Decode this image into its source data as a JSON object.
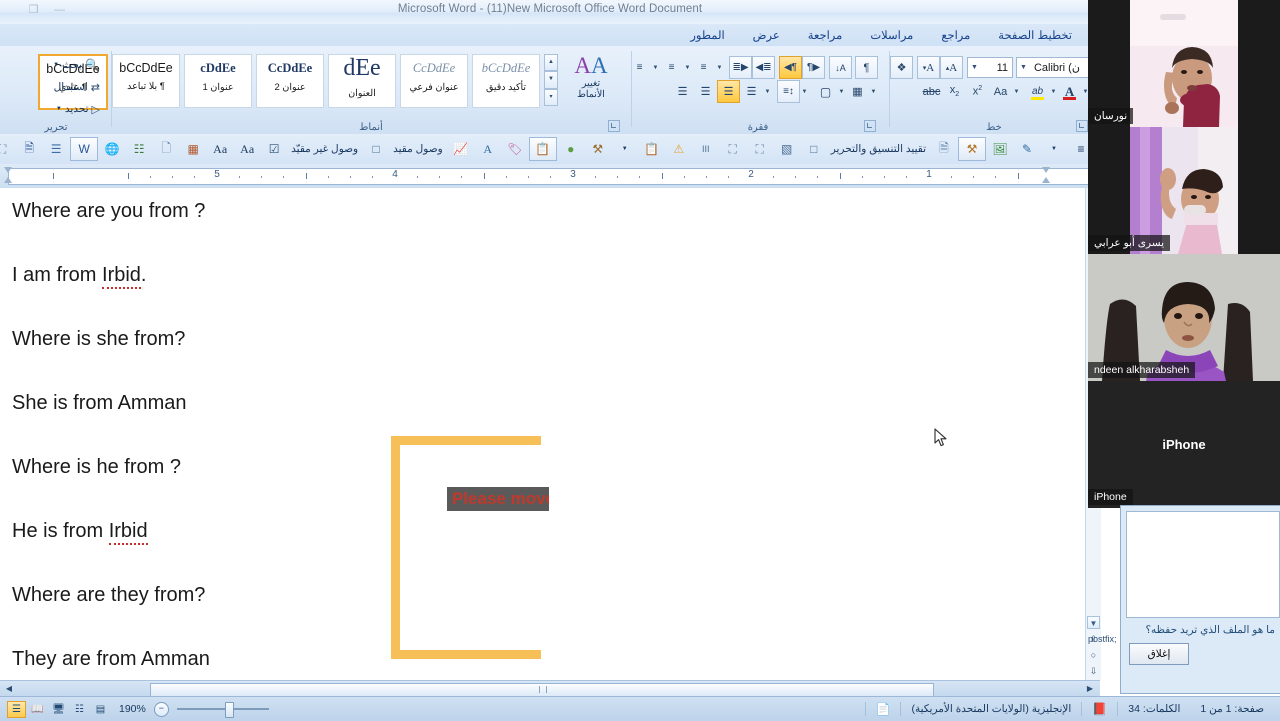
{
  "window": {
    "title": "Microsoft Word - (11)New Microsoft Office Word Document",
    "restore_icon": "restore-icon",
    "minimize_icon": "minimize-icon"
  },
  "ribbon": {
    "tabs": [
      {
        "label": "تخطيط الصفحة"
      },
      {
        "label": "مراجع"
      },
      {
        "label": "مراسلات"
      },
      {
        "label": "مراجعة"
      },
      {
        "label": "عرض"
      },
      {
        "label": "المطور"
      }
    ],
    "font_group": {
      "label": "خط",
      "font_name": "Calibri (ن",
      "font_size": "11",
      "grow_font": "A",
      "shrink_font": "A",
      "clear_formatting_icon": "clear-formatting-icon",
      "text_color": "A",
      "highlight": "ab",
      "change_case": "Aa",
      "superscript": "x²",
      "subscript": "x₂",
      "strikethrough": "abc",
      "text_color_hex": "#d81e1e",
      "highlight_color_hex": "#ffe800"
    },
    "paragraph_group": {
      "label": "فقرة",
      "show_marks": "¶",
      "sort": "A↓",
      "ltr_text": "¶",
      "rtl_text": "¶",
      "decrease_indent": "≡",
      "increase_indent": "≡",
      "multilevel_list": "≡",
      "numbered_list": "≡",
      "bulleted_list": "≡",
      "borders": "▦",
      "shading": "▤",
      "line_spacing": "↕",
      "align_left": "≡",
      "align_center": "≡",
      "align_right": "≡",
      "justify": "≡"
    },
    "styles_group": {
      "label": "أنماط",
      "change_styles_label_line1": "تغيير",
      "change_styles_label_line2": "الأنماط",
      "items": [
        {
          "preview": "bCcDdEe",
          "name": "تأكيد دقيق",
          "selected": false
        },
        {
          "preview": "CcDdEe",
          "name": "عنوان فرعي",
          "selected": false
        },
        {
          "preview": "dEe",
          "name": "العنوان",
          "selected": false
        },
        {
          "preview": "CcDdEe",
          "name": "عنوان 2",
          "selected": false
        },
        {
          "preview": "cDdEe",
          "name": "عنوان 1",
          "selected": false
        },
        {
          "preview": "bCcDdEe",
          "name": "¶ بلا تباعد",
          "selected": false
        },
        {
          "preview": "bCcDdEe",
          "name": "¶ عادي",
          "selected": true
        }
      ]
    },
    "editing_group": {
      "label": "تحرير",
      "find": "بحث",
      "replace": "استبدال",
      "select": "تحديد"
    }
  },
  "addin_toolbar": {
    "restrict_formatting_label": "تقييد التنسيق والتحرير",
    "restricted_access_label": "وصول مقيد",
    "unrestricted_access_label": "وصول غير مقيّد",
    "case_upper": "Aa",
    "case_lower": "Aa",
    "overflow_icon": "overflow-chevron-icon",
    "warning_icon": "warning-icon"
  },
  "ruler": {
    "numbers": [
      "5",
      "4",
      "3",
      "2",
      "1"
    ]
  },
  "document": {
    "lines": [
      {
        "text": "Where are you from ?",
        "misspelled": ""
      },
      {
        "text": "I am from ",
        "misspelled": "Irbid",
        "tail": "."
      },
      {
        "text": "Where is she from?",
        "misspelled": ""
      },
      {
        "text": "She is from Amman",
        "misspelled": ""
      },
      {
        "text": "Where is he from ?",
        "misspelled": ""
      },
      {
        "text": "He is from ",
        "misspelled": "Irbid",
        "tail": ""
      },
      {
        "text": "Where are they from?",
        "misspelled": ""
      },
      {
        "text": "They are from Amman",
        "misspelled": ""
      }
    ],
    "annotation": {
      "text": "Please move",
      "box_color": "#f7bf57",
      "text_color": "#c0392b",
      "text_background": "#5a5a5a"
    }
  },
  "video_panel": {
    "tiles": [
      {
        "name": "نورسان",
        "rtl": true,
        "kind": "camera",
        "center_label": ""
      },
      {
        "name": "يسرى أبو عرابي",
        "rtl": true,
        "kind": "camera",
        "center_label": ""
      },
      {
        "name": "ndeen alkharabsheh",
        "rtl": false,
        "kind": "camera",
        "center_label": ""
      },
      {
        "name": "iPhone",
        "rtl": false,
        "kind": "placeholder",
        "center_label": "iPhone"
      }
    ]
  },
  "save_dialog": {
    "message": "ما هو الملف الذي تريد حفظه؟",
    "close_button": "إغلاق"
  },
  "status_bar": {
    "page": "صفحة: 1 من 1",
    "words": "الكلمات: 34",
    "proofing_icon": "proofing-errors-icon",
    "language": "الإنجليزية (الولايات المتحدة الأمريكية)",
    "macro_icon": "macro-record-icon",
    "zoom_level": "190%",
    "zoom_out": "−",
    "views": [
      {
        "icon": "print-layout-icon",
        "selected": true
      },
      {
        "icon": "full-screen-reading-icon",
        "selected": false
      },
      {
        "icon": "web-layout-icon",
        "selected": false
      },
      {
        "icon": "outline-icon",
        "selected": false
      },
      {
        "icon": "draft-icon",
        "selected": false
      }
    ]
  }
}
